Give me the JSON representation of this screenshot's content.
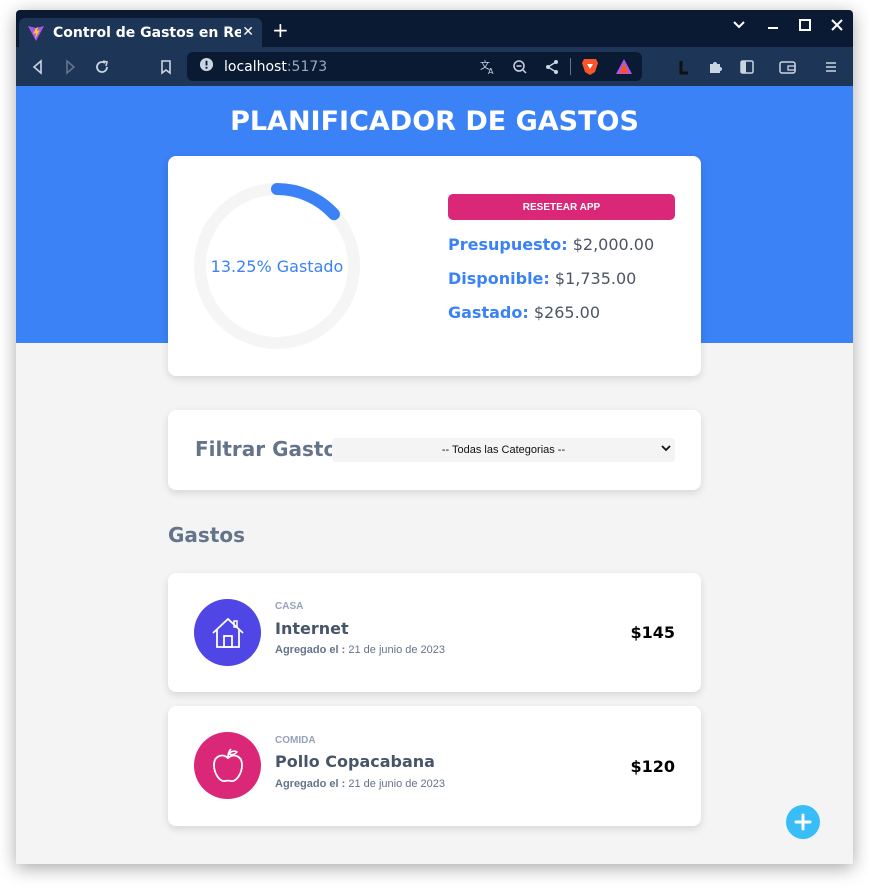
{
  "browser": {
    "tab_title": "Control de Gastos en React",
    "tab_close": "✕",
    "new_tab": "+",
    "url_host": "localhost",
    "url_port": ":5173",
    "window_controls": [
      "⌄",
      "–",
      "☐",
      "✕"
    ]
  },
  "header": {
    "title": "PLANIFICADOR DE GASTOS"
  },
  "budget": {
    "percent": 13.25,
    "percent_label": "13.25% Gastado",
    "reset_label": "RESETEAR APP",
    "budget_label": "Presupuesto:",
    "budget_value": "$2,000.00",
    "available_label": "Disponible:",
    "available_value": "$1,735.00",
    "spent_label": "Gastado:",
    "spent_value": "$265.00",
    "colors": {
      "progress": "#3b82f6",
      "track": "#f5f5f5",
      "reset": "#db2777"
    }
  },
  "filter": {
    "label": "Filtrar Gastos",
    "selected": "-- Todas las Categorias --"
  },
  "expenses": {
    "section_title": "Gastos",
    "items": [
      {
        "category": "CASA",
        "name": "Internet",
        "date_label": "Agregado el :",
        "date": "21 de junio de 2023",
        "amount": "$145",
        "icon": "house-icon",
        "color": "#4f46e5"
      },
      {
        "category": "COMIDA",
        "name": "Pollo Copacabana",
        "date_label": "Agregado el :",
        "date": "21 de junio de 2023",
        "amount": "$120",
        "icon": "apple-icon",
        "color": "#db2777"
      }
    ]
  },
  "fab": {
    "icon": "plus-icon",
    "color": "#38bdf8"
  }
}
